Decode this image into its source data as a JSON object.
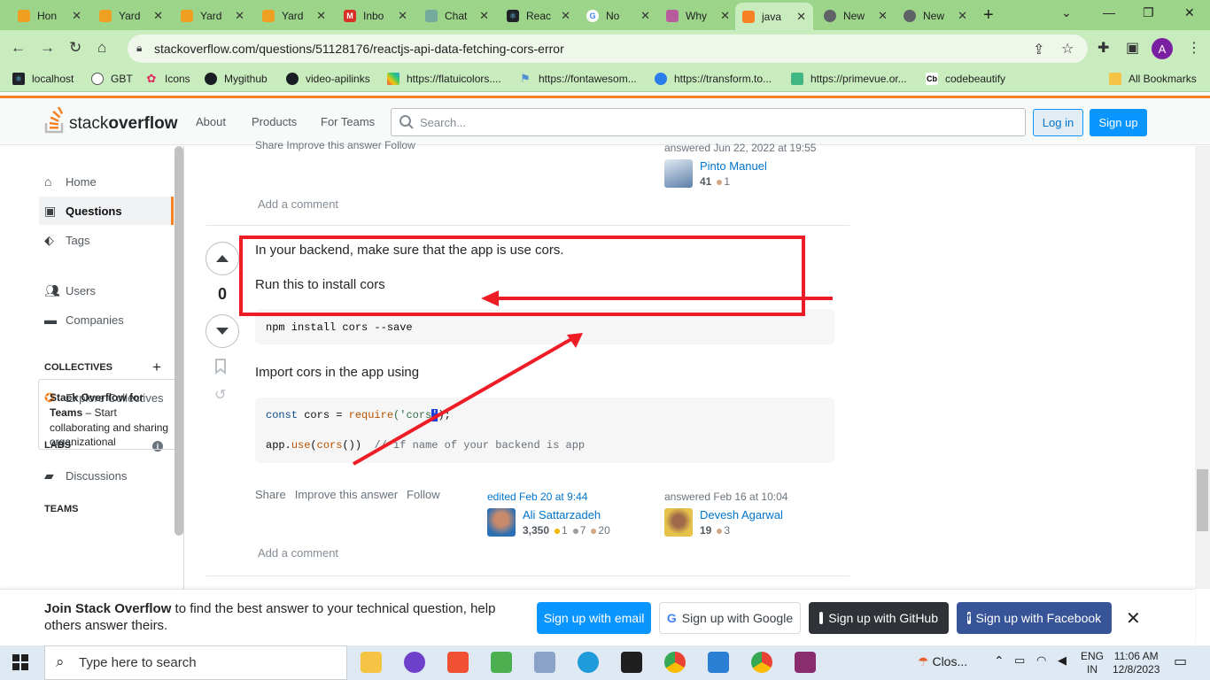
{
  "browser": {
    "tabs": [
      {
        "label": "Hon",
        "color": "#f0a020"
      },
      {
        "label": "Yard",
        "color": "#f0a020"
      },
      {
        "label": "Yard",
        "color": "#f0a020"
      },
      {
        "label": "Yard",
        "color": "#f0a020"
      },
      {
        "label": "Inbo",
        "color": "#d93025"
      },
      {
        "label": "Chat",
        "color": "#74aa9c"
      },
      {
        "label": "Reac",
        "color": "#20232a"
      },
      {
        "label": "No",
        "color": "#4285f4"
      },
      {
        "label": "Why",
        "color": "#b85c9e"
      },
      {
        "label": "java",
        "color": "#f48225"
      },
      {
        "label": "New",
        "color": "#5f6368"
      },
      {
        "label": "New",
        "color": "#5f6368"
      }
    ],
    "url": "stackoverflow.com/questions/51128176/reactjs-api-data-fetching-cors-error",
    "profile_initial": "A",
    "bookmarks": [
      "localhost",
      "GBT",
      "Icons",
      "Mygithub",
      "video-apilinks",
      "https://flatuicolors....",
      "https://fontawesom...",
      "https://transform.to...",
      "https://primevue.or...",
      "codebeautify"
    ],
    "all_bookmarks": "All Bookmarks"
  },
  "so_header": {
    "logo_part1": "stack",
    "logo_part2": "overflow",
    "nav": [
      "About",
      "Products",
      "For Teams"
    ],
    "search_placeholder": "Search...",
    "login": "Log in",
    "signup": "Sign up"
  },
  "sidebar": {
    "items": [
      "Home",
      "Questions",
      "Tags",
      "Users",
      "Companies"
    ],
    "collectives_head": "COLLECTIVES",
    "explore_collectives": "Explore Collectives",
    "labs_head": "LABS",
    "discussions": "Discussions",
    "teams_head": "TEAMS",
    "teams_title": "Stack Overflow for Teams",
    "teams_text": " – Start collaborating and sharing organizational"
  },
  "prev_answer": {
    "menu": "Share  Improve this answer  Follow",
    "answered": "answered Jun 22, 2022 at 19:55",
    "user": "Pinto Manuel",
    "rep": "41",
    "bronze": "1",
    "add_comment": "Add a comment"
  },
  "answer": {
    "vote_count": "0",
    "line1": "In your backend, make sure that the app is use cors.",
    "line2": "Run this to install cors",
    "code1": "npm install cors --save",
    "line3": "Import cors in the app using",
    "code2_kw": "const",
    "code2_rest": " cors = ",
    "code2_fn": "require",
    "code2_str1": "('cors",
    "code2_sel": "'",
    "code2_end": ");",
    "code3_obj": "app.",
    "code3_fn": "use",
    "code3_mid": "(",
    "code3_fn2": "cors",
    "code3_end": "())  ",
    "code3_comment": "// if name of your backend is app",
    "menu_share": "Share",
    "menu_improve": "Improve this answer",
    "menu_follow": "Follow",
    "edited": "edited Feb 20 at 9:44",
    "editor": "Ali Sattarzadeh",
    "editor_rep": "3,350",
    "editor_gold": "1",
    "editor_silver": "7",
    "editor_bronze": "20",
    "answered": "answered Feb 16 at 10:04",
    "author": "Devesh Agarwal",
    "author_rep": "19",
    "author_bronze": "3",
    "add_comment": "Add a comment"
  },
  "join_banner": {
    "bold": "Join Stack Overflow",
    "text": " to find the best answer to your technical question, help others answer theirs.",
    "email": "Sign up with email",
    "google": "Sign up with Google",
    "github": "Sign up with GitHub",
    "facebook": "Sign up with Facebook"
  },
  "taskbar": {
    "search": "Type here to search",
    "weather": "Clos...",
    "lang1": "ENG",
    "lang2": "IN",
    "time": "11:06 AM",
    "date": "12/8/2023"
  }
}
